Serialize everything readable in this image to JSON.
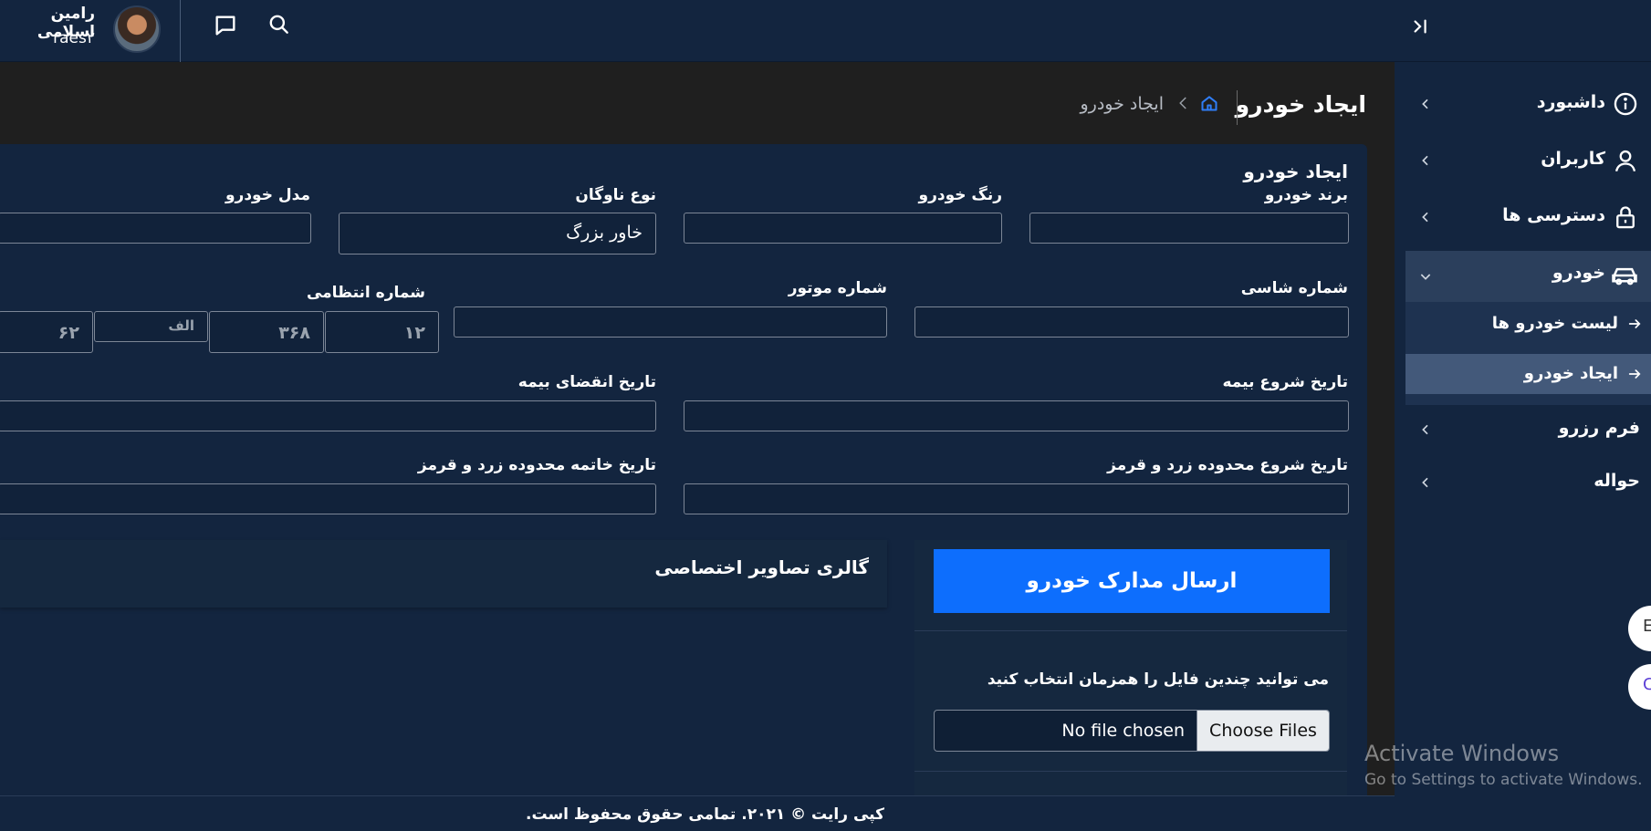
{
  "header": {
    "user_name": "رامین اسلامی",
    "user_role": "raes۲"
  },
  "sidebar": {
    "items": [
      {
        "label": "داشبورد"
      },
      {
        "label": "کاربران"
      },
      {
        "label": "دسترسی ها"
      },
      {
        "label": "خودرو"
      },
      {
        "label": "فرم رزرو"
      },
      {
        "label": "حواله"
      }
    ],
    "sub_items": [
      {
        "label": "لیست خودرو ها"
      },
      {
        "label": "ایجاد خودرو"
      }
    ]
  },
  "page": {
    "title": "ایجاد خودرو",
    "breadcrumb_current": "ایجاد خودرو"
  },
  "form": {
    "title": "ایجاد خودرو",
    "brand_label": "برند خودرو",
    "color_label": "رنگ خودرو",
    "fleet_type_label": "نوع ناوگان",
    "fleet_type_value": "خاور بزرگ",
    "model_label": "مدل خودرو",
    "chassis_label": "شماره شاسی",
    "engine_label": "شماره موتور",
    "plate_label": "شماره انتظامی",
    "plate_parts": [
      "۱۲",
      "۳۶۸",
      "الف",
      "۶۲"
    ],
    "insurance_start_label": "تاریخ شروع بیمه",
    "insurance_end_label": "تاریخ انقضای بیمه",
    "zone_start_label": "تاریخ شروع محدوده زرد و قرمز",
    "zone_end_label": "تاریخ خاتمه محدوده زرد و قرمز"
  },
  "gallery": {
    "title": "گالری تصاویر اختصاصی"
  },
  "upload": {
    "button_label": "ارسال مدارک خودرو",
    "hint": "می توانید چندین فایل را همزمان انتخاب کنید",
    "choose_label": "Choose Files",
    "no_file": "No file chosen"
  },
  "footer": {
    "text": "کپی رایت © ۲۰۲۱. تمامی حقوق محفوظ است."
  },
  "floating": {
    "btn1": "E",
    "btn2": "C"
  },
  "watermark": {
    "line1": "Activate Windows",
    "line2": "Go to Settings to activate Windows."
  },
  "colors": {
    "primary": "#0d6efd",
    "panel": "#13253f",
    "background": "#1f1f1f"
  }
}
